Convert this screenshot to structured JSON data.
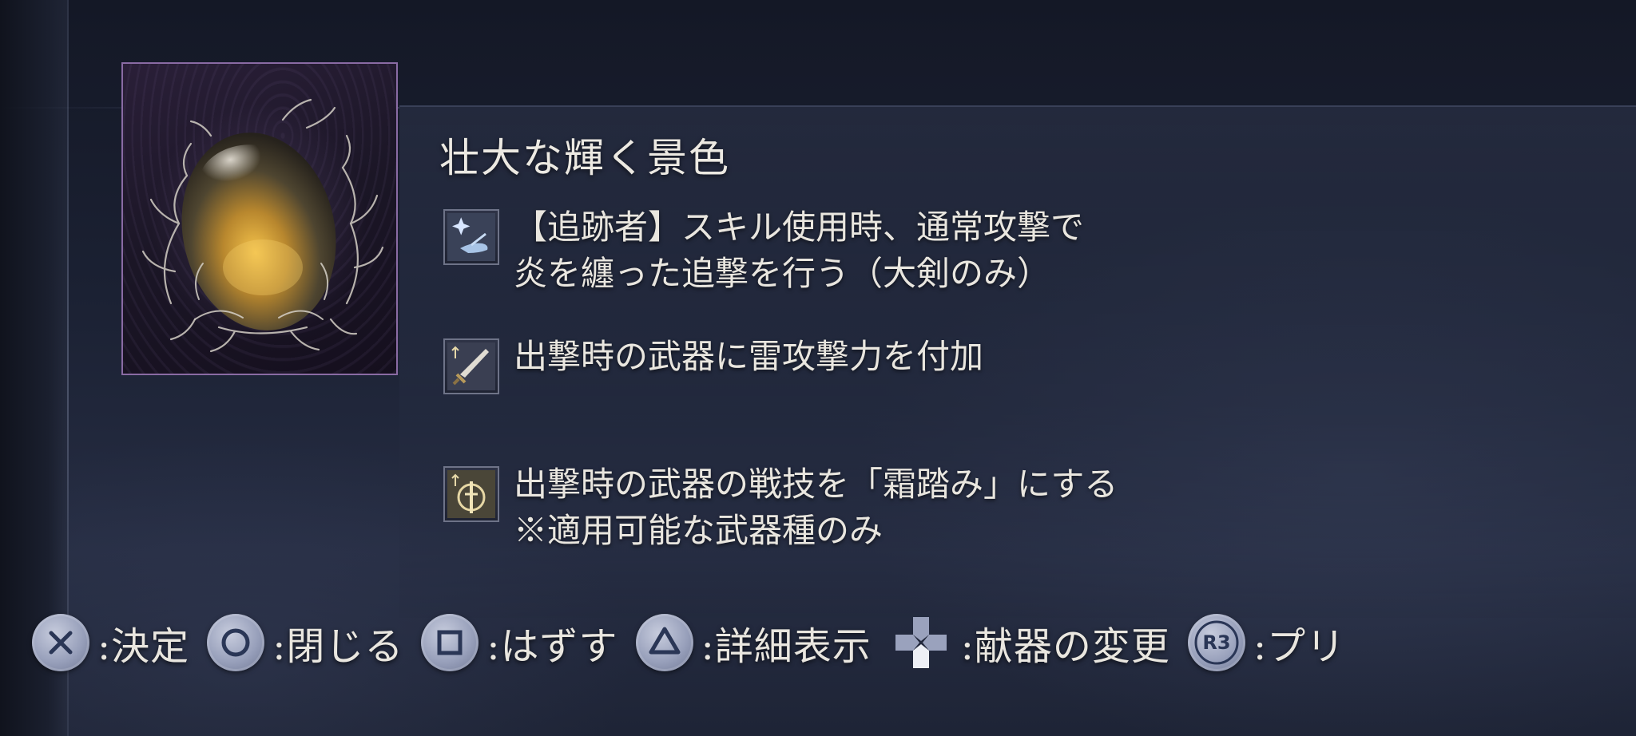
{
  "item": {
    "name": "壮大な輝く景色",
    "icon": "glowing-egg-relic-icon",
    "frame_color": "#8a6ba4"
  },
  "effects": [
    {
      "icon": "tracker-skill-icon",
      "lines": [
        "【追跡者】スキル使用時、通常攻撃で",
        "炎を纏った追撃を行う（大剣のみ）"
      ]
    },
    {
      "icon": "weapon-sword-icon",
      "lines": [
        "出撃時の武器に雷攻撃力を付加"
      ]
    },
    {
      "icon": "weapon-skill-icon",
      "lines": [
        "出撃時の武器の戦技を「霜踏み」にする",
        "※適用可能な武器種のみ"
      ]
    }
  ],
  "controls": [
    {
      "button": "cross-button-icon",
      "label": ":決定"
    },
    {
      "button": "circle-button-icon",
      "label": ":閉じる"
    },
    {
      "button": "square-button-icon",
      "label": ":はずす"
    },
    {
      "button": "triangle-button-icon",
      "label": ":詳細表示"
    },
    {
      "button": "dpad-icon",
      "label": ":献器の変更"
    },
    {
      "button": "r3-button-icon",
      "button_text": "R3",
      "label": ":プリ"
    }
  ]
}
